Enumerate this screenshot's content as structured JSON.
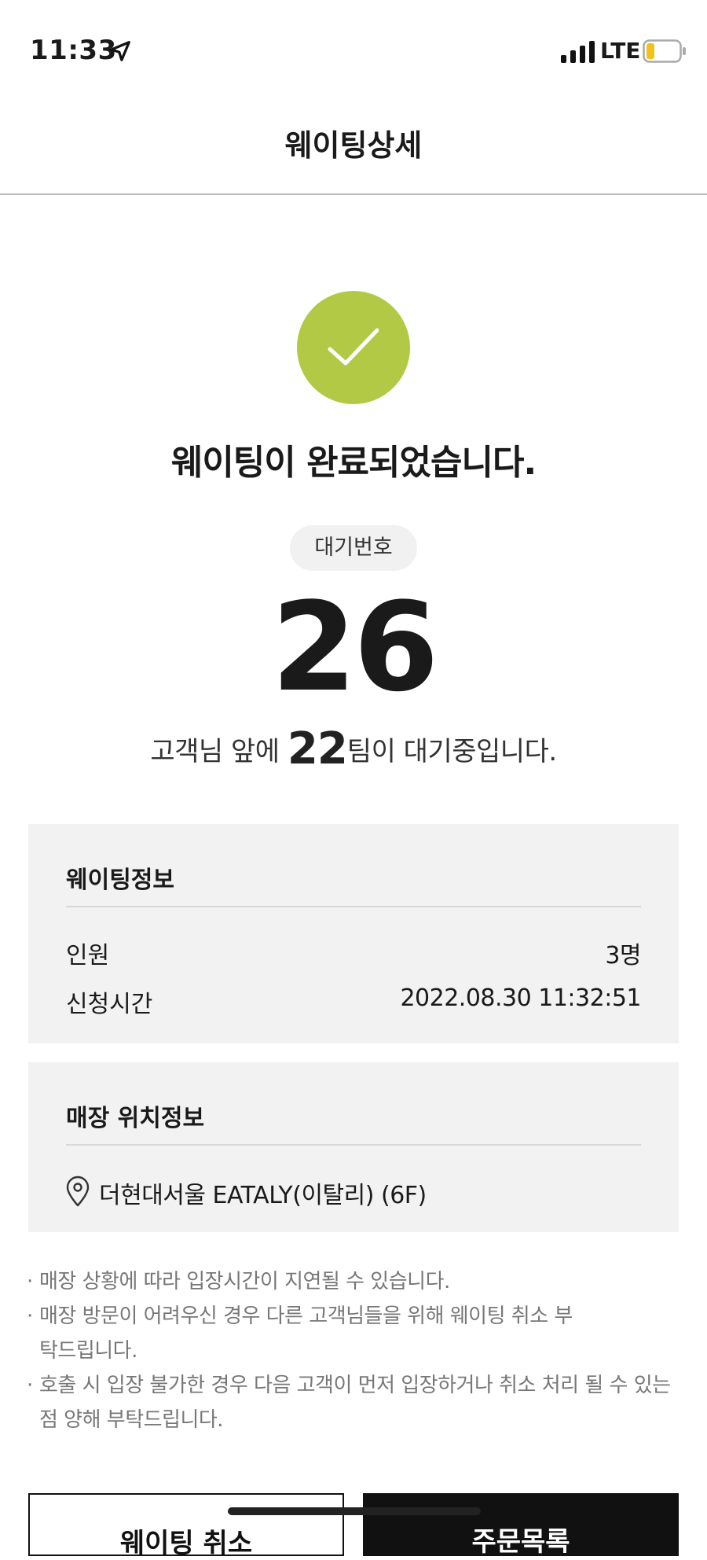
{
  "status_bar": {
    "time": "11:33",
    "network": "LTE"
  },
  "header": {
    "title": "웨이팅상세"
  },
  "result": {
    "title": "웨이팅이 완료되었습니다.",
    "queue_label": "대기번호",
    "queue_number": "26",
    "ahead_prefix": "고객님 앞에 ",
    "ahead_count": "22",
    "ahead_suffix": "팀이 대기중입니다."
  },
  "waiting_info": {
    "title": "웨이팅정보",
    "rows": [
      {
        "label": "인원",
        "value": "3명"
      },
      {
        "label": "신청시간",
        "value": "2022.08.30 11:32:51"
      }
    ]
  },
  "store_location": {
    "title": "매장 위치정보",
    "address": "더현대서울 EATALY(이탈리) (6F)"
  },
  "notes": [
    "매장 상황에 따라 입장시간이 지연될 수 있습니다.",
    "매장 방문이 어려우신 경우 다른 고객님들을 위해 웨이팅 취소 부탁드립니다.",
    "호출 시 입장 불가한 경우 다음 고객이 먼저 입장하거나 취소 처리 될 수 있는 점 양해 부탁드립니다."
  ],
  "buttons": {
    "cancel": "웨이팅 취소",
    "order": "주문목록"
  },
  "colors": {
    "accent": "#b1c944",
    "card_bg": "#f2f2f2",
    "button_dark": "#111111"
  }
}
